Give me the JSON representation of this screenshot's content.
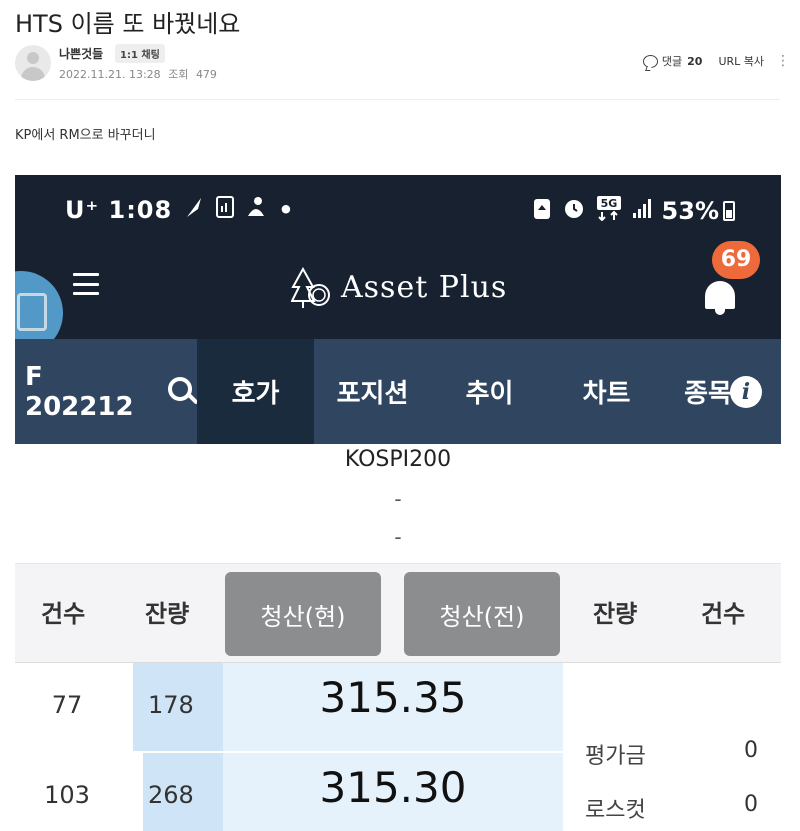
{
  "post": {
    "title": "HTS 이름 또 바꿨네요",
    "author": "나쁜것들",
    "chat_badge": "1:1 채팅",
    "date": "2022.11.21. 13:28",
    "views_label": "조회",
    "views": "479",
    "comment_label": "댓글",
    "comment_count": "20",
    "url_copy": "URL 복사",
    "more": "⋮",
    "body": "KP에서 RM으로 바꾸더니"
  },
  "phone": {
    "status_bar": {
      "carrier_time": "U⁺ 1:08",
      "dot": "•",
      "network": "5G",
      "battery": "53%"
    },
    "app": {
      "name": "Asset  Plus",
      "notification_count": "69"
    },
    "tabs": [
      {
        "label": "F 202212"
      },
      {
        "label": "호가"
      },
      {
        "label": "포지션"
      },
      {
        "label": "추이"
      },
      {
        "label": "차트"
      },
      {
        "label": "종목"
      }
    ],
    "instrument": {
      "name": "KOSPI200",
      "line1": "-",
      "line2": "-"
    },
    "order_header": {
      "left_count": "건수",
      "left_qty": "잔량",
      "settle_now": "청산(현)",
      "settle_all": "청산(전)",
      "right_qty": "잔량",
      "right_count": "건수"
    },
    "asks": [
      {
        "count": "77",
        "qty": "178",
        "price": "315.35"
      },
      {
        "count": "103",
        "qty": "268",
        "price": "315.30"
      }
    ],
    "summary": [
      {
        "label": "평가금",
        "value": "0"
      },
      {
        "label": "로스컷",
        "value": "0"
      }
    ]
  },
  "colors": {
    "app_header": "#17212f",
    "tab_bar": "#2f4560",
    "tab_active": "#1b2b3e",
    "badge": "#ee6a3a",
    "qty_cell": "#cfe4f7",
    "price_cell": "#e6f2fb",
    "settle_button": "#8c8d8f"
  }
}
